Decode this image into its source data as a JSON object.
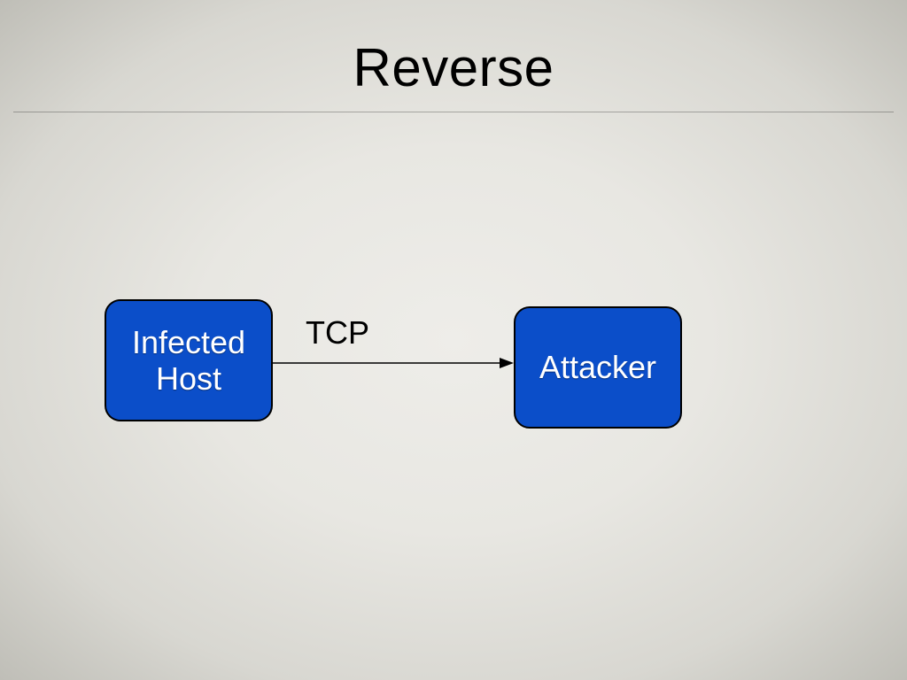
{
  "title": "Reverse",
  "nodes": {
    "left": {
      "label": "Infected\nHost"
    },
    "right": {
      "label": "Attacker"
    }
  },
  "edge": {
    "label": "TCP",
    "from": "left",
    "to": "right"
  }
}
